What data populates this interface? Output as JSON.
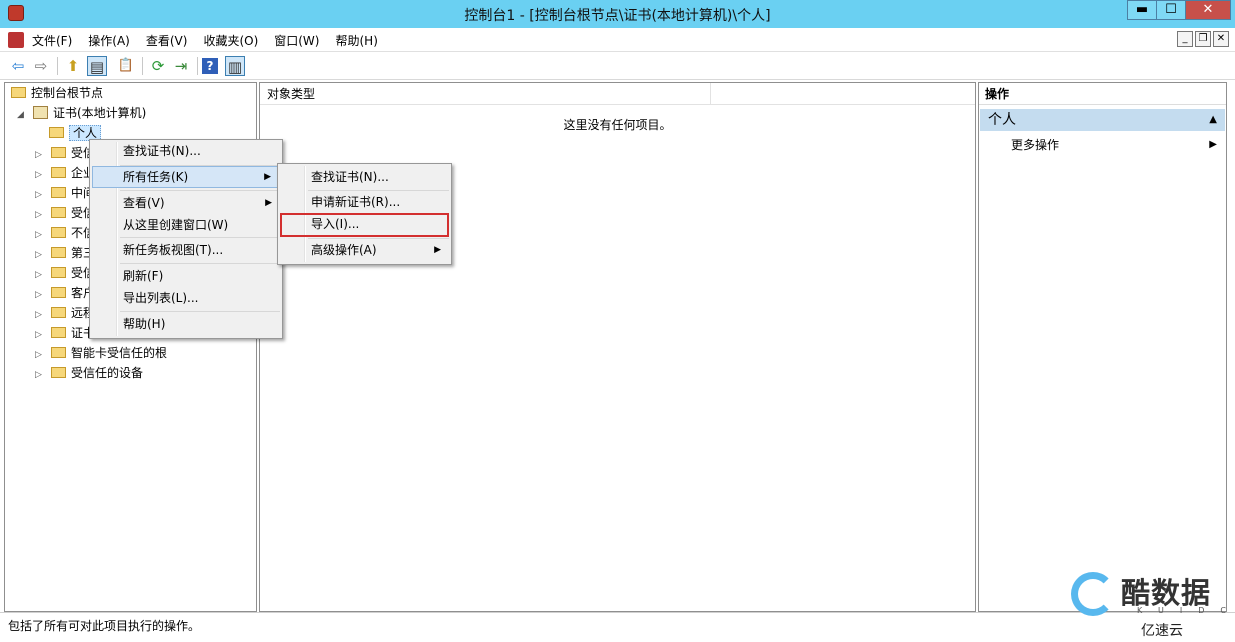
{
  "window": {
    "title": "控制台1 - [控制台根节点\\证书(本地计算机)\\个人]",
    "controls": {
      "minimize": "▬",
      "maximize": "☐",
      "close": "✕"
    }
  },
  "menubar": {
    "items": [
      "文件(F)",
      "操作(A)",
      "查看(V)",
      "收藏夹(O)",
      "窗口(W)",
      "帮助(H)"
    ],
    "mdi_controls": {
      "minimize": "_",
      "restore": "❐",
      "close": "✕"
    }
  },
  "toolbar": {
    "icons": [
      "back-arrow-icon",
      "forward-arrow-icon",
      "up-folder-icon",
      "show-hide-tree-icon",
      "clipboard-icon",
      "refresh-icon",
      "export-list-icon",
      "help-icon",
      "show-hide-action-pane-icon"
    ],
    "glyphs": {
      "back": "⇦",
      "forward": "⇨",
      "up": "⬆",
      "tree": "▤",
      "clipboard": "📋",
      "refresh": "⟳",
      "export": "⇥",
      "help": "?",
      "actionpane": "▥"
    }
  },
  "tree": {
    "root": "控制台根节点",
    "certs": "证书(本地计算机)",
    "personal": "个人",
    "children": [
      "受信",
      "企业",
      "中间",
      "受信",
      "不信",
      "第三",
      "受信",
      "客户",
      "远程",
      "证书",
      "智能卡受信任的根",
      "受信任的设备"
    ]
  },
  "center": {
    "column_header": "对象类型",
    "empty_message": "这里没有任何项目。"
  },
  "actions_pane": {
    "header": "操作",
    "group": "个人",
    "collapse_glyph": "▲",
    "more_actions": "更多操作",
    "more_arrow": "▶"
  },
  "context_menu": {
    "items": [
      "查找证书(N)...",
      "所有任务(K)",
      "查看(V)",
      "从这里创建窗口(W)",
      "新任务板视图(T)...",
      "刷新(F)",
      "导出列表(L)...",
      "帮助(H)"
    ],
    "submenu_arrow": "▶"
  },
  "submenu": {
    "items": [
      "查找证书(N)...",
      "申请新证书(R)...",
      "导入(I)...",
      "高级操作(A)"
    ]
  },
  "statusbar": {
    "text": "包括了所有可对此项目执行的操作。"
  },
  "watermark": {
    "brand": "酷数据",
    "sub": "KUIDC",
    "brand2": "亿速云"
  },
  "colors": {
    "titlebar": "#6ad0f2",
    "highlight": "#d5e6f7",
    "redbox": "#d32f2f",
    "action_group": "#c4dcef"
  }
}
